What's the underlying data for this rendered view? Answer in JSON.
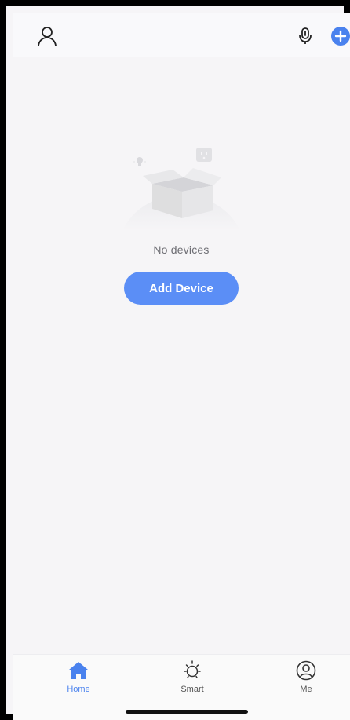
{
  "header": {
    "profile_icon": "person-outline-icon",
    "mic_icon": "microphone-icon",
    "add_icon": "plus-circle-icon"
  },
  "empty_state": {
    "illustration": "open-box-illustration",
    "message": "No devices",
    "button_label": "Add Device"
  },
  "tabbar": {
    "items": [
      {
        "label": "Home",
        "icon": "home-icon",
        "active": true
      },
      {
        "label": "Smart",
        "icon": "sun-icon",
        "active": false
      },
      {
        "label": "Me",
        "icon": "user-circle-icon",
        "active": false
      }
    ]
  },
  "colors": {
    "accent": "#5b8ef6",
    "active_tab": "#4a82ee",
    "background": "#f6f5f7"
  }
}
